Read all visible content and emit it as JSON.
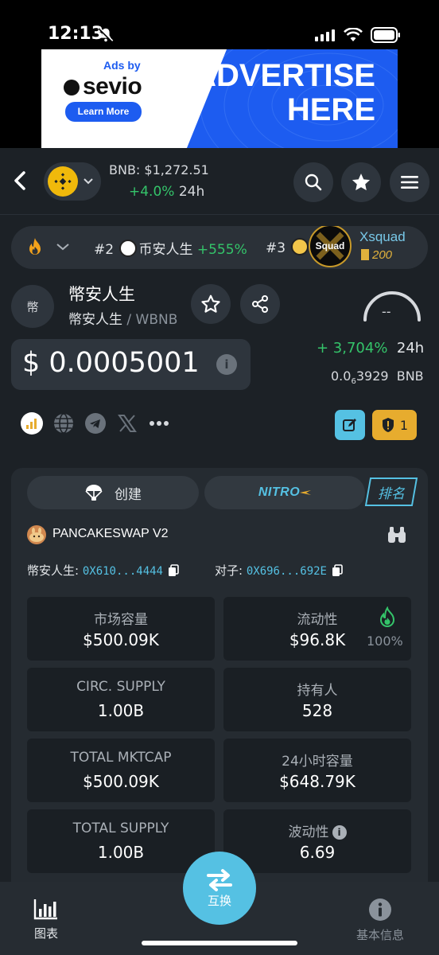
{
  "status_bar": {
    "time": "12:13"
  },
  "ad": {
    "ads_by": "Ads by",
    "brand": "sevio",
    "learn_more": "Learn More",
    "headline_line1": "ADVERTISE",
    "headline_line2": "HERE"
  },
  "header": {
    "bnb_price": "BNB: $1,272.51",
    "bnb_change": "+4.0%",
    "bnb_change_period": "24h"
  },
  "trending": {
    "item2_rank": "#2",
    "item2_name": "币安人生",
    "item2_change": "+555%",
    "item3_rank": "#3",
    "item3_logo_text": "Squad",
    "item3_name": "Xsquad",
    "item3_score": "200"
  },
  "token": {
    "avatar_text": "幣",
    "name": "幣安人生",
    "pair_base": "幣安人生",
    "pair_sep": " / ",
    "pair_quote": "WBNB",
    "gauge_value": "--",
    "price": "$ 0.0005001",
    "change": "+ 3,704%",
    "change_period": "24h",
    "price_bnb_prefix": "0.0",
    "price_bnb_sub": "6",
    "price_bnb_rest": "3929",
    "price_bnb_unit": "BNB",
    "audit_count": "1"
  },
  "tabs": {
    "create": "创建",
    "nitro": "NITRO",
    "rank": "排名"
  },
  "dex": {
    "name": "PANCAKESWAP V2"
  },
  "addresses": {
    "token_label": "幣安人生:",
    "token_addr": "0X610...4444",
    "pair_label": "对子:",
    "pair_addr": "0X696...692E"
  },
  "stats": [
    {
      "label": "市场容量",
      "value": "$500.09K"
    },
    {
      "label": "流动性",
      "value": "$96.8K",
      "extra": "100%"
    },
    {
      "label": "CIRC. SUPPLY",
      "value": "1.00B"
    },
    {
      "label": "持有人",
      "value": "528"
    },
    {
      "label": "TOTAL MKTCAP",
      "value": "$500.09K"
    },
    {
      "label": "24小时容量",
      "value": "$648.79K"
    },
    {
      "label": "TOTAL SUPPLY",
      "value": "1.00B"
    },
    {
      "label": "波动性",
      "value": "6.69"
    }
  ],
  "bottom_nav": {
    "chart": "图表",
    "swap": "互换",
    "info": "基本信息"
  },
  "colors": {
    "accent": "#55c1e3",
    "positive": "#34c46a",
    "background": "#1c2126",
    "bnb": "#f0b90b",
    "audit": "#e7ac2e"
  }
}
